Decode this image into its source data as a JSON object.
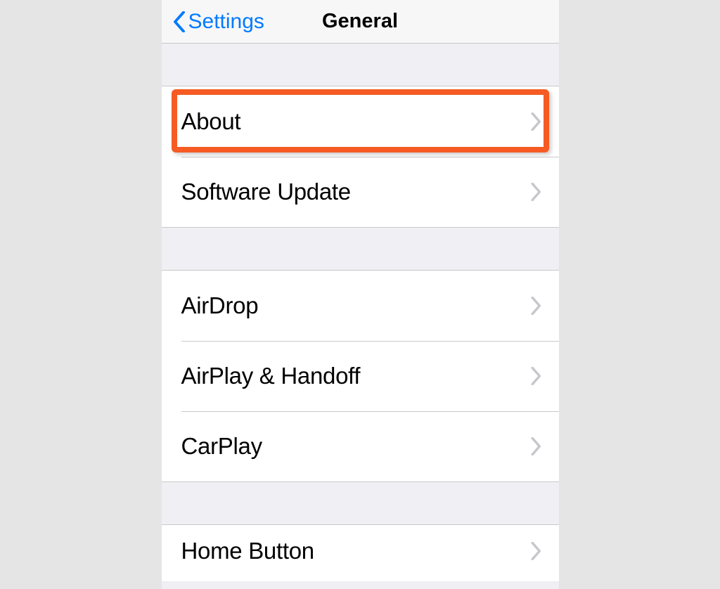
{
  "nav": {
    "back_label": "Settings",
    "title": "General"
  },
  "sections": [
    {
      "rows": [
        {
          "label": "About",
          "highlighted": true
        },
        {
          "label": "Software Update",
          "highlighted": false
        }
      ]
    },
    {
      "rows": [
        {
          "label": "AirDrop",
          "highlighted": false
        },
        {
          "label": "AirPlay & Handoff",
          "highlighted": false
        },
        {
          "label": "CarPlay",
          "highlighted": false
        }
      ]
    },
    {
      "rows": [
        {
          "label": "Home Button",
          "highlighted": false
        }
      ]
    }
  ],
  "colors": {
    "highlight": "#f55b23",
    "link": "#007aff",
    "chevron": "#c7c7cc"
  }
}
